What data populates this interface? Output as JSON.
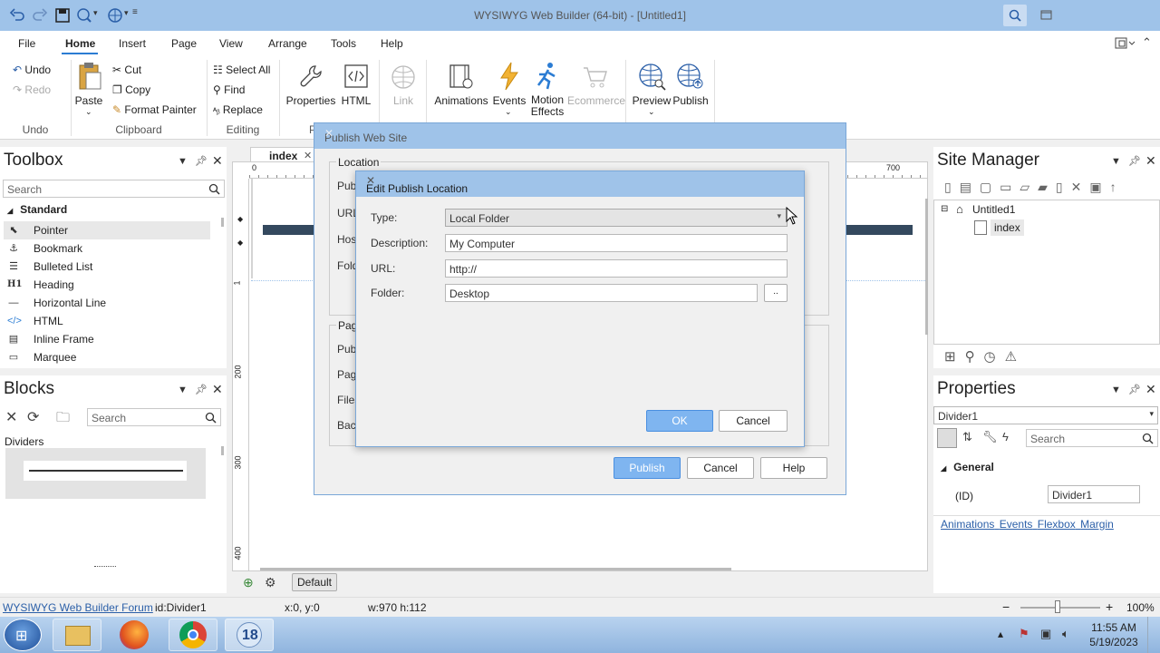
{
  "app": {
    "title": "WYSIWYG Web Builder (64-bit) - [Untitled1]"
  },
  "menu": {
    "items": [
      "File",
      "Home",
      "Insert",
      "Page",
      "View",
      "Arrange",
      "Tools",
      "Help"
    ],
    "active": "Home"
  },
  "ribbon": {
    "undo": "Undo",
    "redo": "Redo",
    "group_undo": "Undo",
    "paste": "Paste",
    "cut": "Cut",
    "copy": "Copy",
    "format_painter": "Format Painter",
    "group_clipboard": "Clipboard",
    "select_all": "Select All",
    "find": "Find",
    "replace": "Replace",
    "group_editing": "Editing",
    "properties": "Properties",
    "html": "HTML",
    "link": "Link",
    "group_p": "P",
    "animations": "Animations",
    "events": "Events",
    "motion": "Motion",
    "effects": "Effects",
    "ecommerce": "Ecommerce",
    "preview": "Preview",
    "publish": "Publish"
  },
  "toolbox": {
    "title": "Toolbox",
    "search_placeholder": "Search",
    "category": "Standard",
    "items": [
      {
        "label": "Pointer",
        "icon": "pointer-icon"
      },
      {
        "label": "Bookmark",
        "icon": "anchor-icon"
      },
      {
        "label": "Bulleted List",
        "icon": "list-icon"
      },
      {
        "label": "Heading",
        "icon": "heading-icon"
      },
      {
        "label": "Horizontal Line",
        "icon": "line-icon"
      },
      {
        "label": "HTML",
        "icon": "code-icon"
      },
      {
        "label": "Inline Frame",
        "icon": "frame-icon"
      },
      {
        "label": "Marquee",
        "icon": "marquee-icon"
      }
    ]
  },
  "blocks": {
    "title": "Blocks",
    "search_placeholder": "Search",
    "category": "Dividers"
  },
  "editor": {
    "tab": "index",
    "ruler_top": [
      "0",
      "700"
    ],
    "ruler_left": [
      "1",
      "200",
      "300",
      "400"
    ],
    "default_label": "Default"
  },
  "site_manager": {
    "title": "Site Manager",
    "root": "Untitled1",
    "page": "index"
  },
  "properties": {
    "title": "Properties",
    "object": "Divider1",
    "search_placeholder": "Search",
    "section": "General",
    "id_label": "(ID)",
    "id_value": "Divider1",
    "links": [
      "Animations",
      "Events",
      "Flexbox",
      "Margin"
    ]
  },
  "publish_dialog": {
    "title": "Publish Web Site",
    "location_group": "Location",
    "labels": [
      "Publ",
      "URL",
      "Host",
      "Fold"
    ],
    "page_group": "Page",
    "labels2": [
      "Publ",
      "Page",
      "Files",
      "Back"
    ],
    "publish": "Publish",
    "cancel": "Cancel",
    "help": "Help"
  },
  "edit_dialog": {
    "title": "Edit Publish Location",
    "type_label": "Type:",
    "type_value": "Local Folder",
    "description_label": "Description:",
    "description_value": "My Computer",
    "url_label": "URL:",
    "url_value": "http://",
    "folder_label": "Folder:",
    "folder_value": "Desktop",
    "browse": "..",
    "ok": "OK",
    "cancel": "Cancel"
  },
  "status": {
    "forum": "WYSIWYG Web Builder Forum",
    "id": "id:Divider1",
    "pos": "x:0, y:0",
    "size": "w:970 h:112",
    "zoom": "100%"
  },
  "taskbar": {
    "time": "11:55 AM",
    "date": "5/19/2023",
    "badge": "18"
  },
  "colors": {
    "titlebar": "#9fc3e9",
    "accent": "#2b7cd3",
    "divider": "#34495e"
  }
}
